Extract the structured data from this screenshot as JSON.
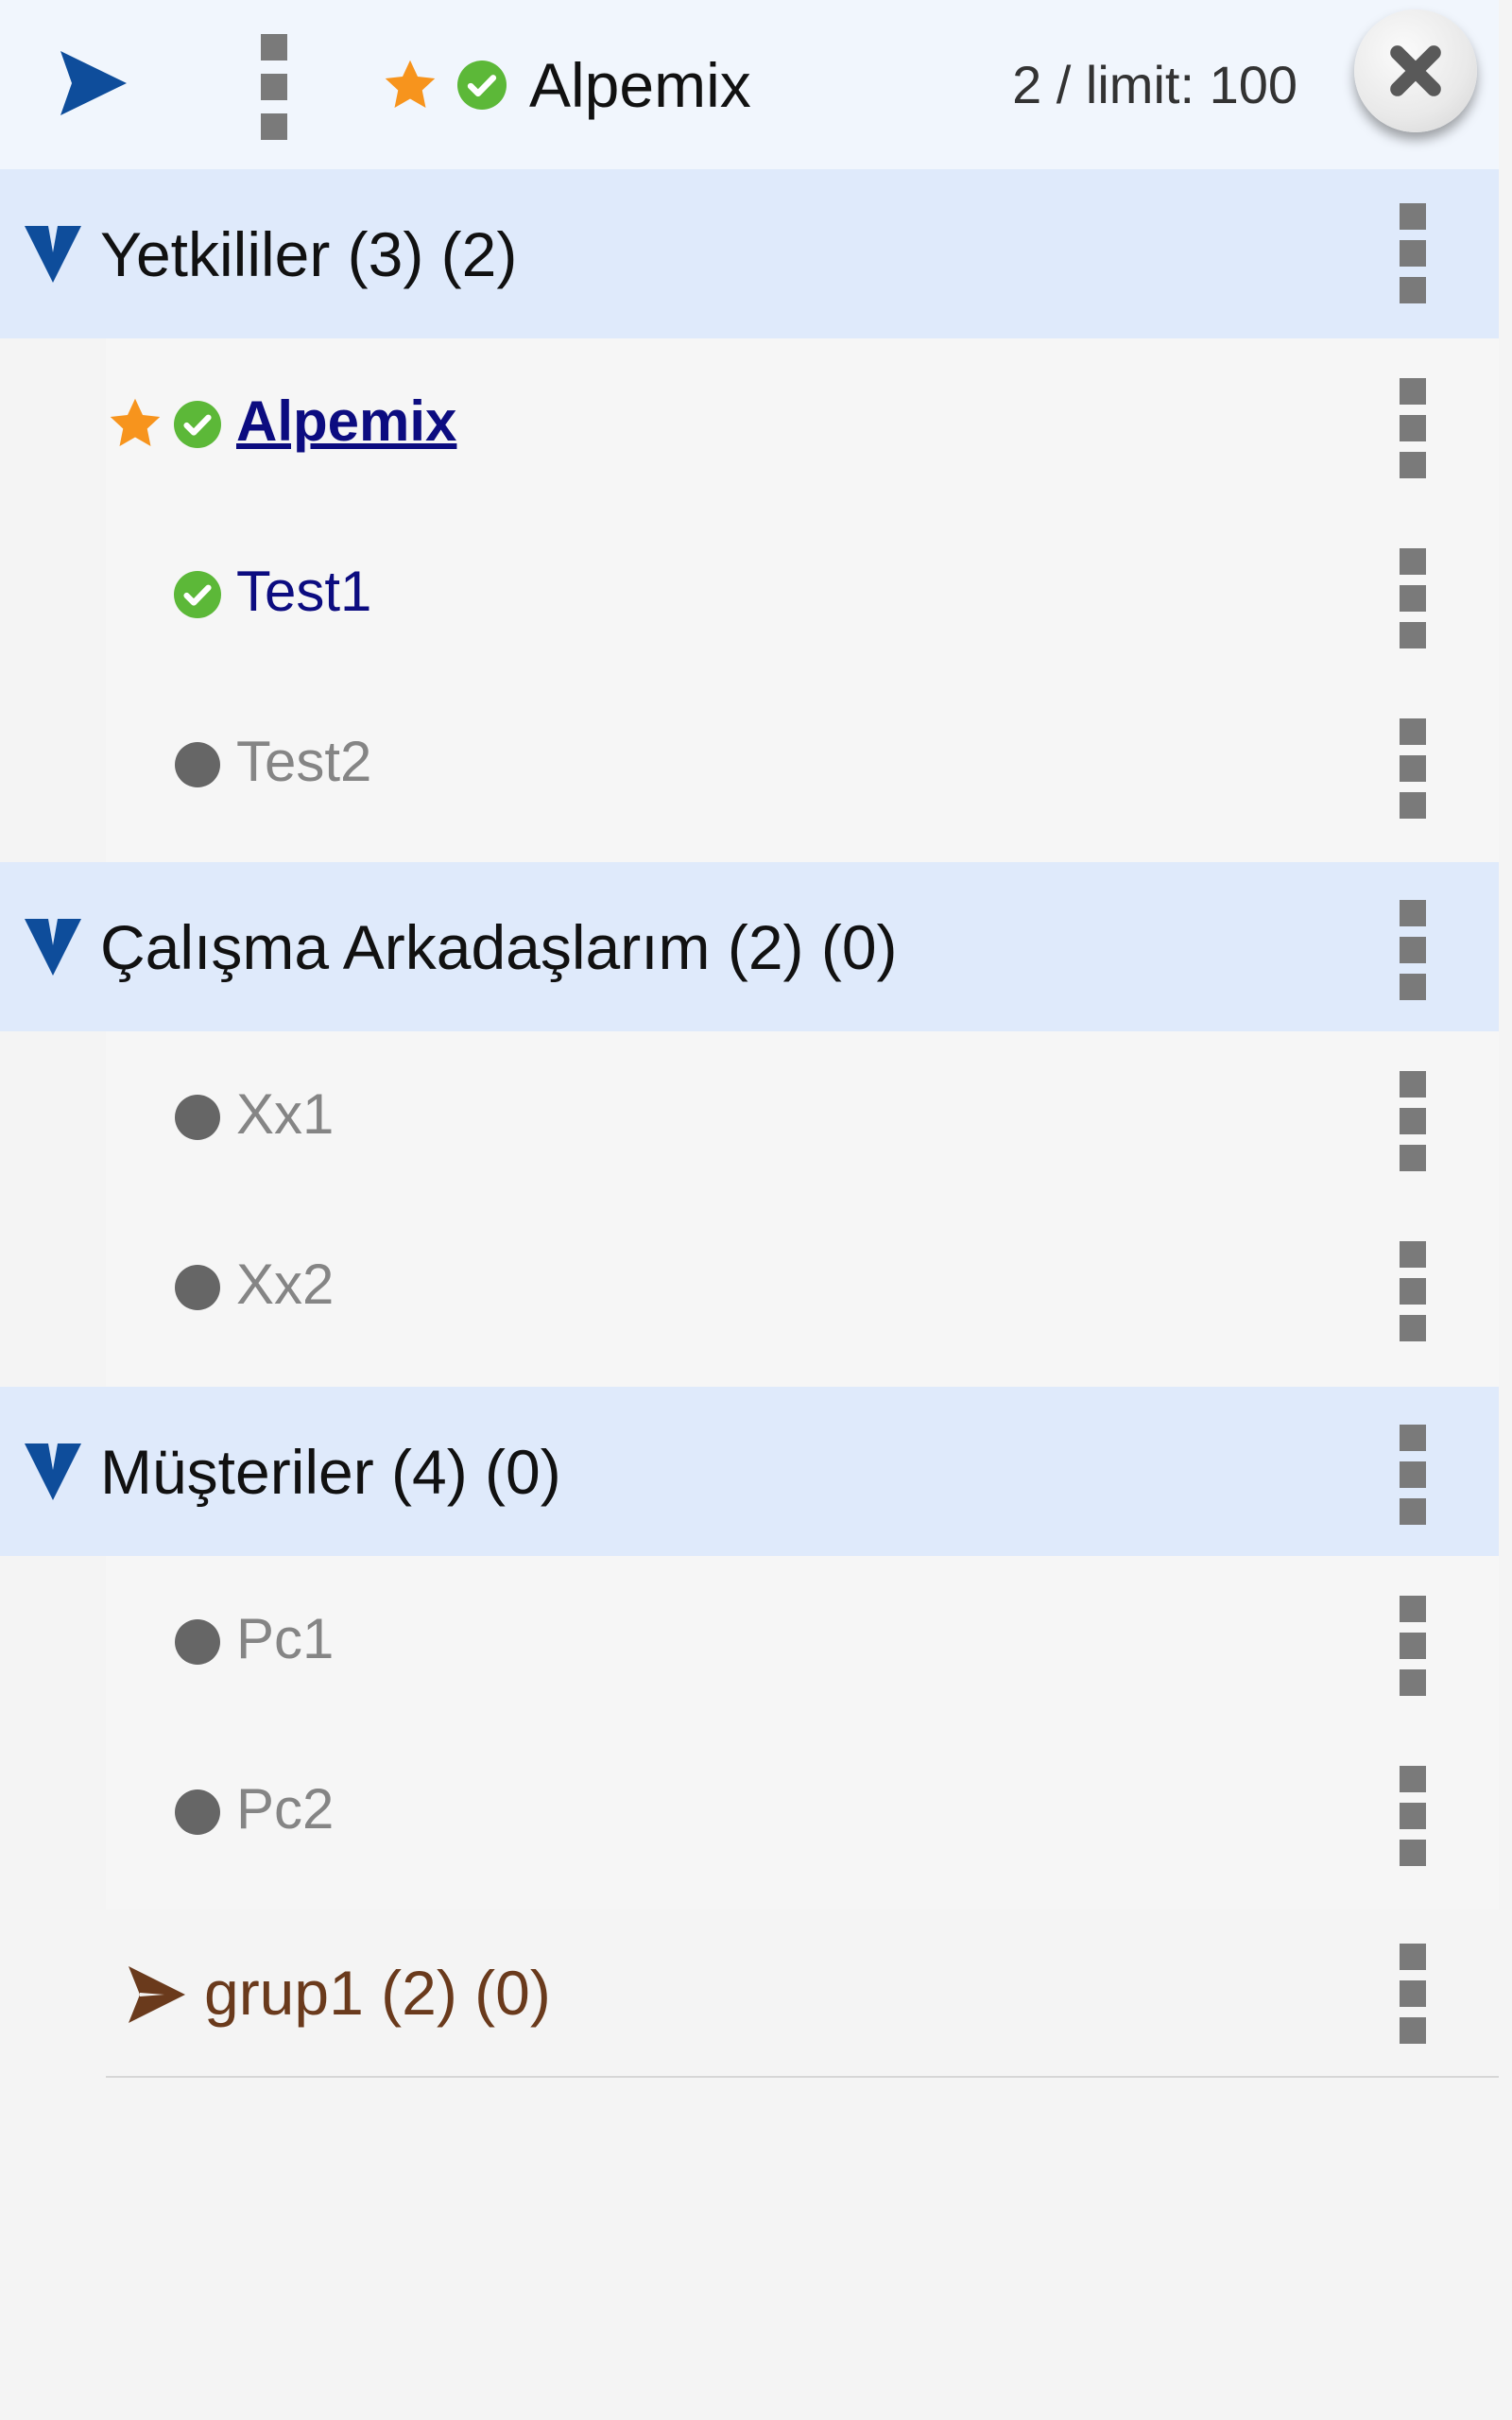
{
  "header": {
    "title": "Alpemix",
    "count": "2 / limit: 100",
    "icons": [
      "send-icon",
      "overflow-menu-icon",
      "star-icon",
      "online-check-icon",
      "close-icon"
    ]
  },
  "colors": {
    "accent": "#0e4d9b",
    "group_bg": "#dfeafb",
    "online_name": "#0c0c80",
    "offline_name": "#858585",
    "status_online": "#5cb838",
    "status_offline": "#666666",
    "favorite": "#f7941d",
    "subgroup_text": "#6a3a1c"
  },
  "groups": [
    {
      "label": "Yetkililer (3) (2)",
      "items": [
        {
          "name": "Alpemix",
          "status": "online",
          "favorite": true,
          "self": true
        },
        {
          "name": "Test1",
          "status": "online",
          "favorite": false
        },
        {
          "name": "Test2",
          "status": "offline",
          "favorite": false
        }
      ]
    },
    {
      "label": "Çalışma Arkadaşlarım (2) (0)",
      "items": [
        {
          "name": "Xx1",
          "status": "offline",
          "favorite": false
        },
        {
          "name": "Xx2",
          "status": "offline",
          "favorite": false
        }
      ]
    },
    {
      "label": "Müşteriler (4) (0)",
      "items": [
        {
          "name": "Pc1",
          "status": "offline",
          "favorite": false
        },
        {
          "name": "Pc2",
          "status": "offline",
          "favorite": false
        }
      ],
      "subgroups": [
        {
          "label": "grup1 (2) (0)",
          "collapsed": true
        }
      ]
    }
  ]
}
